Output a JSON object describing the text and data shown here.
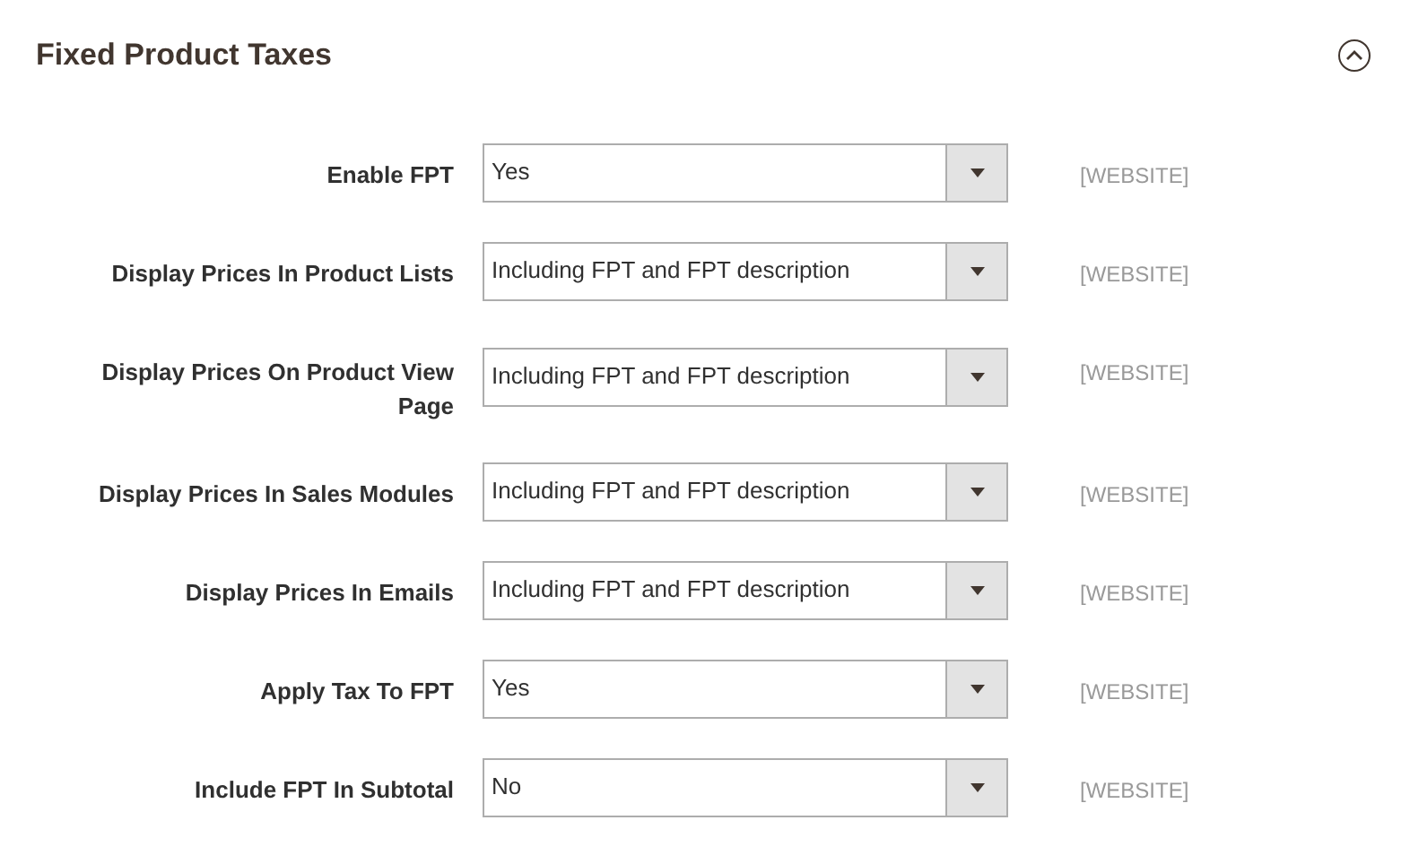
{
  "section": {
    "title": "Fixed Product Taxes",
    "expanded": true
  },
  "fields": [
    {
      "label": "Enable FPT",
      "value": "Yes",
      "scope": "[WEBSITE]"
    },
    {
      "label": "Display Prices In Product Lists",
      "value": "Including FPT and FPT description",
      "scope": "[WEBSITE]"
    },
    {
      "label": "Display Prices On Product View Page",
      "value": "Including FPT and FPT description",
      "scope": "[WEBSITE]"
    },
    {
      "label": "Display Prices In Sales Modules",
      "value": "Including FPT and FPT description",
      "scope": "[WEBSITE]"
    },
    {
      "label": "Display Prices In Emails",
      "value": "Including FPT and FPT description",
      "scope": "[WEBSITE]"
    },
    {
      "label": "Apply Tax To FPT",
      "value": "Yes",
      "scope": "[WEBSITE]"
    },
    {
      "label": "Include FPT In Subtotal",
      "value": "No",
      "scope": "[WEBSITE]"
    }
  ]
}
